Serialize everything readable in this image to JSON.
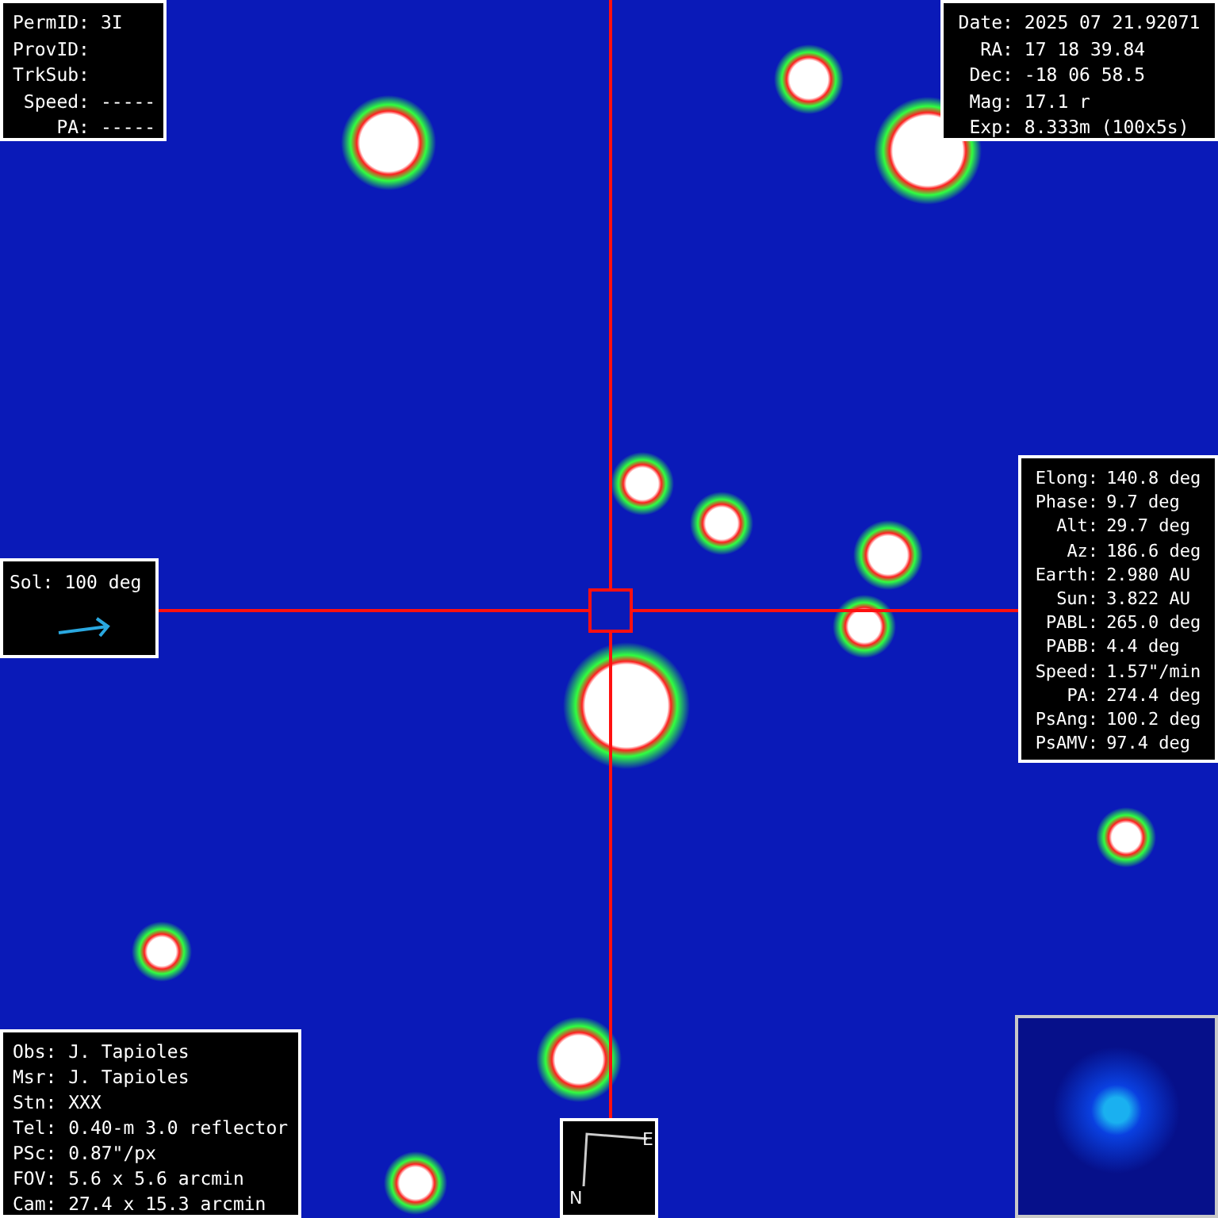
{
  "object_panel": [
    {
      "label": "PermID:",
      "value": "3I"
    },
    {
      "label": "ProvID:"
    },
    {
      "label": "TrkSub:"
    },
    {
      "label": "Speed:",
      "value": "-----"
    },
    {
      "label": "PA:",
      "value": "-----"
    }
  ],
  "observation_panel": [
    {
      "label": "Date:",
      "value": "2025 07 21.92071"
    },
    {
      "label": "RA:",
      "value": "17 18 39.84"
    },
    {
      "label": "Dec:",
      "value": "-18 06 58.5"
    },
    {
      "label": "Mag:",
      "value": "17.1 r"
    },
    {
      "label": "Exp:",
      "value": "8.333m (100x5s)"
    }
  ],
  "geometry_panel": [
    {
      "label": "Elong:",
      "value": "140.8 deg"
    },
    {
      "label": "Phase:",
      "value": "9.7 deg"
    },
    {
      "label": "Alt:",
      "value": "29.7 deg"
    },
    {
      "label": "Az:",
      "value": "186.6 deg"
    },
    {
      "label": "Earth:",
      "value": "2.980 AU"
    },
    {
      "label": "Sun:",
      "value": "3.822 AU"
    },
    {
      "label": "PABL:",
      "value": "265.0 deg"
    },
    {
      "label": "PABB:",
      "value": "4.4 deg"
    },
    {
      "label": "Speed:",
      "value": "1.57\"/min"
    },
    {
      "label": "PA:",
      "value": "274.4 deg"
    },
    {
      "label": "PsAng:",
      "value": "100.2 deg"
    },
    {
      "label": "PsAMV:",
      "value": "97.4 deg"
    }
  ],
  "sun_panel": {
    "label": "Sol:",
    "value": "100 deg"
  },
  "observer_panel": [
    {
      "label": "Obs:",
      "value": "J. Tapioles"
    },
    {
      "label": "Msr:",
      "value": "J. Tapioles"
    },
    {
      "label": "Stn:",
      "value": "XXX"
    },
    {
      "label": "Tel:",
      "value": "0.40-m 3.0 reflector"
    },
    {
      "label": "PSc:",
      "value": "0.87\"/px"
    },
    {
      "label": "FOV:",
      "value": "5.6 x 5.6 arcmin"
    },
    {
      "label": "Cam:",
      "value": "27.4 x 15.3 arcmin"
    }
  ],
  "compass": {
    "north": "N",
    "east": "E"
  }
}
